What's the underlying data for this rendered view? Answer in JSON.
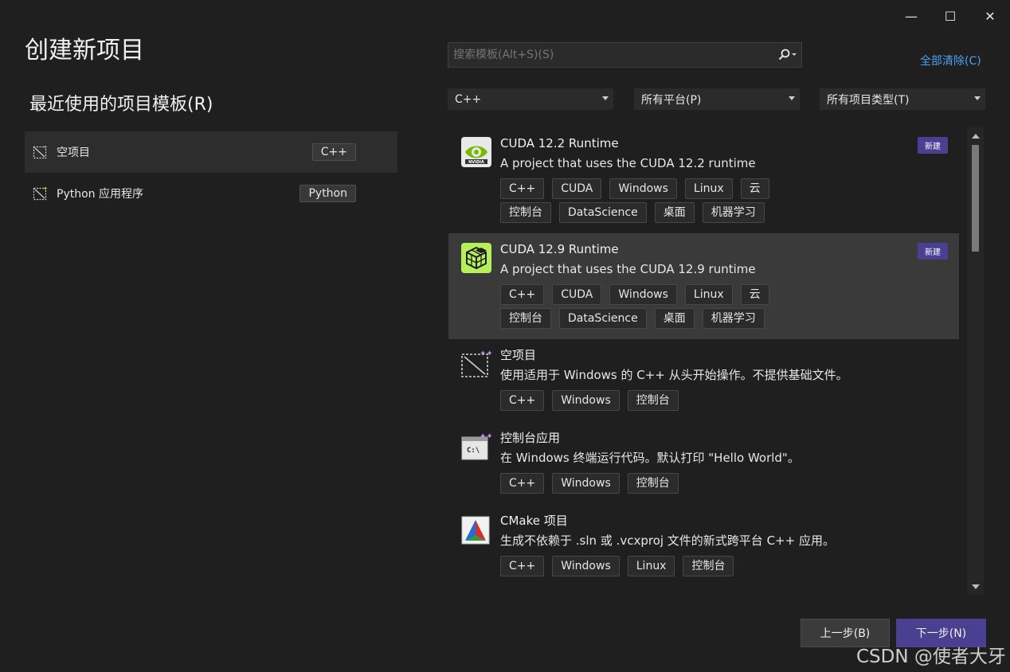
{
  "window": {
    "minimize_glyph": "—",
    "maximize_glyph": "☐",
    "close_glyph": "✕"
  },
  "title": "创建新项目",
  "recent": {
    "heading": "最近使用的项目模板(R)",
    "items": [
      {
        "label": "空项目",
        "tag": "C++",
        "icon": "empty-project-icon",
        "selected": true
      },
      {
        "label": "Python 应用程序",
        "tag": "Python",
        "icon": "python-app-icon",
        "selected": false
      }
    ]
  },
  "search": {
    "placeholder": "搜索模板(Alt+S)(S)",
    "icon": "search-icon"
  },
  "clear_all": "全部清除(C)",
  "filters": {
    "language": "C++",
    "platform": "所有平台(P)",
    "project_type": "所有项目类型(T)"
  },
  "templates": [
    {
      "title": "CUDA 12.2 Runtime",
      "desc": "A project that uses the CUDA 12.2 runtime",
      "badge": "新建",
      "icon": "nvidia-icon",
      "selected": false,
      "tags": [
        "C++",
        "CUDA",
        "Windows",
        "Linux",
        "云",
        "控制台",
        "DataScience",
        "桌面",
        "机器学习"
      ]
    },
    {
      "title": "CUDA 12.9 Runtime",
      "desc": "A project that uses the CUDA 12.9 runtime",
      "badge": "新建",
      "icon": "cuda-cube-icon",
      "selected": true,
      "tags": [
        "C++",
        "CUDA",
        "Windows",
        "Linux",
        "云",
        "控制台",
        "DataScience",
        "桌面",
        "机器学习"
      ]
    },
    {
      "title": "空项目",
      "desc": "使用适用于 Windows 的 C++ 从头开始操作。不提供基础文件。",
      "badge": "",
      "icon": "empty-project-icon",
      "selected": false,
      "tags": [
        "C++",
        "Windows",
        "控制台"
      ]
    },
    {
      "title": "控制台应用",
      "desc": "在 Windows 终端运行代码。默认打印 \"Hello World\"。",
      "badge": "",
      "icon": "console-app-icon",
      "selected": false,
      "tags": [
        "C++",
        "Windows",
        "控制台"
      ]
    },
    {
      "title": "CMake 项目",
      "desc": "生成不依赖于 .sln 或 .vcxproj 文件的新式跨平台 C++ 应用。",
      "badge": "",
      "icon": "cmake-icon",
      "selected": false,
      "tags": [
        "C++",
        "Windows",
        "Linux",
        "控制台"
      ]
    }
  ],
  "buttons": {
    "back": "上一步(B)",
    "next": "下一步(N)"
  },
  "watermark": "CSDN @使者大牙",
  "colors": {
    "accent": "#4b3f91",
    "link": "#4aa2f0",
    "background": "#1f1f1f"
  }
}
